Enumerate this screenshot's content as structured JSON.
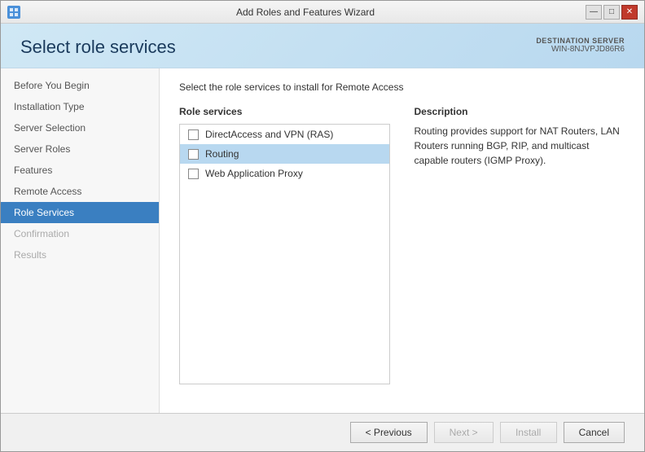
{
  "window": {
    "title": "Add Roles and Features Wizard",
    "controls": {
      "minimize": "—",
      "maximize": "□",
      "close": "✕"
    }
  },
  "header": {
    "page_title": "Select role services",
    "destination_label": "DESTINATION SERVER",
    "server_name": "WIN-8NJVPJD86R6"
  },
  "sidebar": {
    "items": [
      {
        "label": "Before You Begin",
        "state": "normal"
      },
      {
        "label": "Installation Type",
        "state": "normal"
      },
      {
        "label": "Server Selection",
        "state": "normal"
      },
      {
        "label": "Server Roles",
        "state": "normal"
      },
      {
        "label": "Features",
        "state": "normal"
      },
      {
        "label": "Remote Access",
        "state": "normal"
      },
      {
        "label": "Role Services",
        "state": "active"
      },
      {
        "label": "Confirmation",
        "state": "dimmed"
      },
      {
        "label": "Results",
        "state": "dimmed"
      }
    ]
  },
  "content": {
    "instruction": "Select the role services to install for Remote Access",
    "role_services_header": "Role services",
    "services": [
      {
        "label": "DirectAccess and VPN (RAS)",
        "checked": false,
        "selected": false
      },
      {
        "label": "Routing",
        "checked": false,
        "selected": true
      },
      {
        "label": "Web Application Proxy",
        "checked": false,
        "selected": false
      }
    ],
    "description_header": "Description",
    "description_text": "Routing provides support for NAT Routers, LAN Routers running BGP, RIP, and multicast capable routers (IGMP Proxy)."
  },
  "footer": {
    "previous_label": "< Previous",
    "next_label": "Next >",
    "install_label": "Install",
    "cancel_label": "Cancel"
  }
}
